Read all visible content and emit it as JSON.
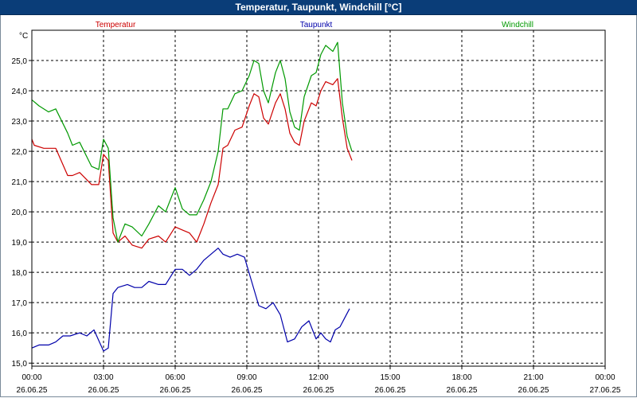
{
  "window": {
    "title": "Temperatur, Taupunkt, Windchill [°C]"
  },
  "chart_data": {
    "type": "line",
    "title": "Temperatur, Taupunkt, Windchill [°C]",
    "ylabel": "°C",
    "ylim": [
      14.9,
      26.0
    ],
    "xlim": [
      0,
      24
    ],
    "grid": true,
    "legend_position": "top",
    "y_ticks": [
      "15,0",
      "16,0",
      "17,0",
      "18,0",
      "19,0",
      "20,0",
      "21,0",
      "22,0",
      "23,0",
      "24,0",
      "25,0"
    ],
    "x_ticks": [
      {
        "time": "00:00",
        "date": "26.06.25"
      },
      {
        "time": "03:00",
        "date": "26.06.25"
      },
      {
        "time": "06:00",
        "date": "26.06.25"
      },
      {
        "time": "09:00",
        "date": "26.06.25"
      },
      {
        "time": "12:00",
        "date": "26.06.25"
      },
      {
        "time": "15:00",
        "date": "26.06.25"
      },
      {
        "time": "18:00",
        "date": "26.06.25"
      },
      {
        "time": "21:00",
        "date": "26.06.25"
      },
      {
        "time": "00:00",
        "date": "27.06.25"
      }
    ],
    "series": [
      {
        "name": "Temperatur",
        "color": "#cc0000",
        "x": [
          0,
          0.1,
          0.5,
          1,
          1.5,
          1.7,
          2,
          2.5,
          2.8,
          3,
          3.2,
          3.4,
          3.6,
          3.9,
          4.2,
          4.6,
          4.9,
          5.3,
          5.6,
          6,
          6.3,
          6.6,
          6.9,
          7.2,
          7.5,
          7.8,
          8,
          8.2,
          8.5,
          8.8,
          9.1,
          9.3,
          9.5,
          9.7,
          9.9,
          10.2,
          10.4,
          10.6,
          10.8,
          11,
          11.2,
          11.4,
          11.7,
          11.9,
          12.1,
          12.3,
          12.6,
          12.8,
          13,
          13.2,
          13.4
        ],
        "y": [
          22.4,
          22.2,
          22.1,
          22.1,
          21.2,
          21.2,
          21.3,
          20.9,
          20.9,
          21.9,
          21.7,
          19.3,
          19.0,
          19.2,
          18.9,
          18.8,
          19.1,
          19.2,
          19.0,
          19.5,
          19.4,
          19.3,
          19.0,
          19.6,
          20.3,
          20.9,
          22.1,
          22.2,
          22.7,
          22.8,
          23.5,
          23.9,
          23.8,
          23.1,
          22.9,
          23.6,
          23.9,
          23.4,
          22.6,
          22.3,
          22.2,
          23.0,
          23.6,
          23.5,
          24.0,
          24.3,
          24.2,
          24.4,
          23.1,
          22.1,
          21.7
        ]
      },
      {
        "name": "Taupunkt",
        "color": "#0000aa",
        "x": [
          0,
          0.3,
          0.7,
          1,
          1.3,
          1.6,
          2,
          2.3,
          2.6,
          3,
          3.2,
          3.4,
          3.6,
          4,
          4.3,
          4.6,
          4.9,
          5.3,
          5.6,
          6,
          6.3,
          6.6,
          6.9,
          7.2,
          7.5,
          7.8,
          8,
          8.3,
          8.6,
          8.9,
          9.2,
          9.5,
          9.8,
          10.1,
          10.4,
          10.7,
          11,
          11.3,
          11.6,
          11.9,
          12.1,
          12.3,
          12.5,
          12.7,
          12.9,
          13.1,
          13.3
        ],
        "y": [
          15.5,
          15.6,
          15.6,
          15.7,
          15.9,
          15.9,
          16.0,
          15.9,
          16.1,
          15.4,
          15.5,
          17.3,
          17.5,
          17.6,
          17.5,
          17.5,
          17.7,
          17.6,
          17.6,
          18.1,
          18.1,
          17.9,
          18.1,
          18.4,
          18.6,
          18.8,
          18.6,
          18.5,
          18.6,
          18.5,
          17.7,
          16.9,
          16.8,
          17.0,
          16.6,
          15.7,
          15.8,
          16.2,
          16.4,
          15.8,
          16.0,
          15.8,
          15.7,
          16.1,
          16.2,
          16.5,
          16.8
        ]
      },
      {
        "name": "Windchill",
        "color": "#009900",
        "x": [
          0,
          0.3,
          0.7,
          1,
          1.5,
          1.7,
          2,
          2.5,
          2.8,
          3,
          3.2,
          3.4,
          3.6,
          3.9,
          4.2,
          4.6,
          4.9,
          5.3,
          5.6,
          6,
          6.3,
          6.6,
          6.9,
          7.2,
          7.5,
          7.8,
          8,
          8.2,
          8.5,
          8.8,
          9.1,
          9.3,
          9.5,
          9.7,
          9.9,
          10.2,
          10.4,
          10.6,
          10.8,
          11,
          11.2,
          11.4,
          11.7,
          11.9,
          12.1,
          12.3,
          12.6,
          12.8,
          13,
          13.2,
          13.4
        ],
        "y": [
          23.7,
          23.5,
          23.3,
          23.4,
          22.6,
          22.2,
          22.3,
          21.5,
          21.4,
          22.4,
          22.1,
          19.8,
          19.0,
          19.6,
          19.5,
          19.2,
          19.6,
          20.2,
          20.0,
          20.8,
          20.1,
          19.9,
          19.9,
          20.4,
          21.0,
          22.0,
          23.4,
          23.4,
          23.9,
          24.0,
          24.5,
          25.0,
          24.9,
          24.0,
          23.6,
          24.6,
          25.0,
          24.4,
          23.3,
          22.8,
          22.7,
          23.8,
          24.5,
          24.6,
          25.2,
          25.5,
          25.3,
          25.6,
          23.6,
          22.5,
          22.0
        ]
      }
    ]
  }
}
